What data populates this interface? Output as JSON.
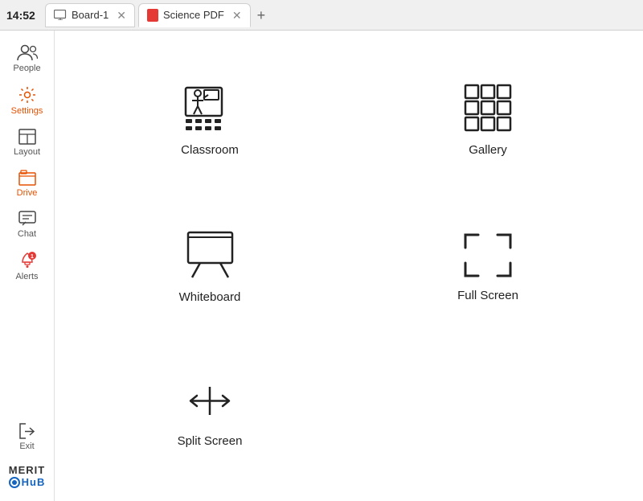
{
  "time": "14:52",
  "tabs": [
    {
      "id": "board",
      "label": "Board-1",
      "icon": "board",
      "active": false,
      "closable": true
    },
    {
      "id": "science",
      "label": "Science PDF",
      "icon": "pdf",
      "active": true,
      "closable": true
    }
  ],
  "tab_add_label": "+",
  "sidebar": {
    "items": [
      {
        "id": "people",
        "label": "People",
        "icon": "people",
        "badge": null
      },
      {
        "id": "settings",
        "label": "Settings",
        "icon": "settings",
        "badge": null
      },
      {
        "id": "layout",
        "label": "Layout",
        "icon": "layout",
        "badge": null
      },
      {
        "id": "drive",
        "label": "Drive",
        "icon": "drive",
        "badge": null
      },
      {
        "id": "chat",
        "label": "Chat",
        "icon": "chat",
        "badge": null
      },
      {
        "id": "alerts",
        "label": "Alerts",
        "icon": "alerts",
        "badge": "1"
      }
    ],
    "exit": {
      "label": "Exit",
      "icon": "exit"
    },
    "brand": {
      "name": "MERIT",
      "sub": "HuB"
    }
  },
  "views": [
    {
      "id": "classroom",
      "label": "Classroom",
      "icon": "classroom"
    },
    {
      "id": "gallery",
      "label": "Gallery",
      "icon": "gallery"
    },
    {
      "id": "whiteboard",
      "label": "Whiteboard",
      "icon": "whiteboard"
    },
    {
      "id": "fullscreen",
      "label": "Full Screen",
      "icon": "fullscreen"
    },
    {
      "id": "splitscreen",
      "label": "Split Screen",
      "icon": "splitscreen"
    }
  ]
}
